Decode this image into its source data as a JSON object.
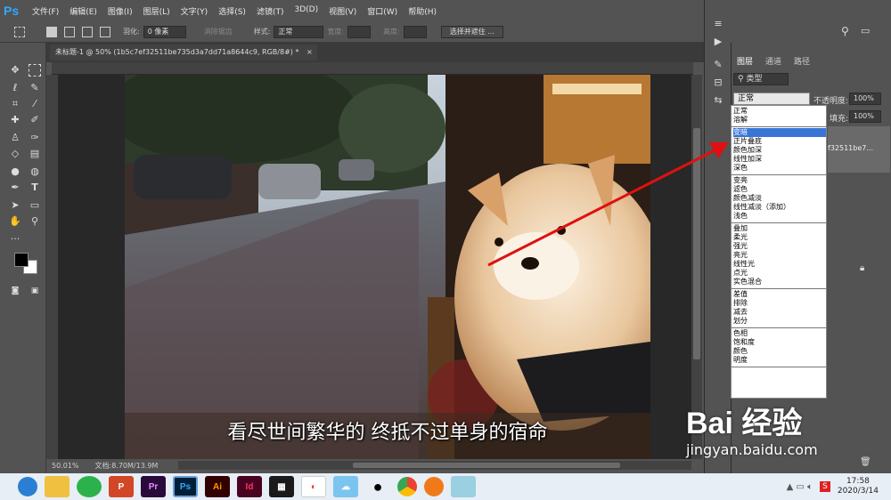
{
  "app": {
    "logo": "Ps"
  },
  "menu": [
    "文件(F)",
    "编辑(E)",
    "图像(I)",
    "图层(L)",
    "文字(Y)",
    "选择(S)",
    "滤镜(T)",
    "3D(D)",
    "视图(V)",
    "窗口(W)",
    "帮助(H)"
  ],
  "options": {
    "feather_label": "羽化:",
    "feather_value": "0 像素",
    "antialias_label": "消除锯齿",
    "style_label": "样式:",
    "style_value": "正常",
    "width_label": "宽度:",
    "height_label": "高度:",
    "select_mask_button": "选择并遮住 ..."
  },
  "document": {
    "tab_title": "未标题-1 @ 50% (1b5c7ef32511be735d3a7dd71a8644c9, RGB/8#) *",
    "caption": "看尽世间繁华的 终抵不过单身的宿命"
  },
  "status": {
    "zoom": "50.01%",
    "doc_size": "文档:8.70M/13.9M"
  },
  "panel": {
    "tabs": [
      "图层",
      "通道",
      "路径"
    ],
    "kind_label": "类型",
    "blend_mode_value": "正常",
    "opacity_label": "不透明度:",
    "opacity_value": "100%",
    "fill_label": "填充:",
    "fill_value": "100%",
    "layer_name_partial": "f32511be7..."
  },
  "blend_modes": [
    [
      "正常",
      "溶解"
    ],
    [
      "变暗",
      "正片叠底",
      "颜色加深",
      "线性加深",
      "深色"
    ],
    [
      "变亮",
      "滤色",
      "颜色减淡",
      "线性减淡（添加）",
      "浅色"
    ],
    [
      "叠加",
      "柔光",
      "强光",
      "亮光",
      "线性光",
      "点光",
      "实色混合"
    ],
    [
      "差值",
      "排除",
      "减去",
      "划分"
    ],
    [
      "色相",
      "饱和度",
      "颜色",
      "明度"
    ]
  ],
  "selected_blend_mode": "变暗",
  "taskbar": {
    "apps": [
      "Pr",
      "Ps",
      "Ai",
      "Id"
    ],
    "time": "17:58",
    "date": "2020/3/14"
  },
  "watermark": {
    "text": "Bai 经验",
    "url": "jingyan.baidu.com"
  },
  "colors": {
    "accent": "#31a8ff",
    "arrow": "#e01010",
    "selection": "#3875d7"
  }
}
